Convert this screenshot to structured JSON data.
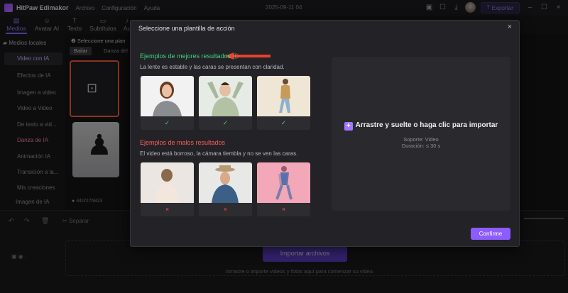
{
  "app": {
    "name": "HitPaw Edimakor",
    "menu": [
      "Archivo",
      "Configuración",
      "Ayuda"
    ],
    "date": "2025-09-11 04",
    "export_label": "Exportar"
  },
  "top_tabs": [
    {
      "label": "Medios",
      "icon": "media-icon"
    },
    {
      "label": "Avatar AI",
      "icon": "avatar-ai-icon"
    },
    {
      "label": "Texto",
      "icon": "text-icon"
    },
    {
      "label": "Subtítulos",
      "icon": "subtitles-icon"
    },
    {
      "label": "Au",
      "icon": "audio-icon"
    }
  ],
  "sidebar": {
    "folder": "Medios locales",
    "items": [
      "Video con IA",
      "Efectos de IA",
      "Imagen a video",
      "Video a Video",
      "De texto a vid...",
      "Danza de IA",
      "Animación IA",
      "Transición a la...",
      "Mis creaciones"
    ],
    "bottom": "Imagen de IA"
  },
  "panel": {
    "step": "Seleccione una plan",
    "pills": [
      "Bailar",
      "Danza del"
    ],
    "credits": "340/276823"
  },
  "toolbar": {
    "separate": "Separar"
  },
  "timeline": {
    "import_label": "Importar archivos",
    "hint": "Arrastre o importe videos y fotos aquí para comenzar su video."
  },
  "modal": {
    "title": "Seleccione una plantilla de acción",
    "good_title": "Ejemplos de mejores resultados",
    "good_desc": "La lente es estable y las caras se presentan con claridad.",
    "bad_title": "Ejemplos de malos resultados",
    "bad_desc": "El video está borroso, la cámara tiembla y no se ven las caras.",
    "good_mark": "✓",
    "bad_mark": "×",
    "drop_main": "Arrastre y suelte o haga clic para importar",
    "drop_support": "Soporte: Video",
    "drop_duration": "Duración: ≤ 30 s",
    "confirm_label": "Confirme"
  },
  "colors": {
    "accent": "#8d5cff",
    "good": "#3ed27a",
    "bad": "#ff5a5a"
  }
}
